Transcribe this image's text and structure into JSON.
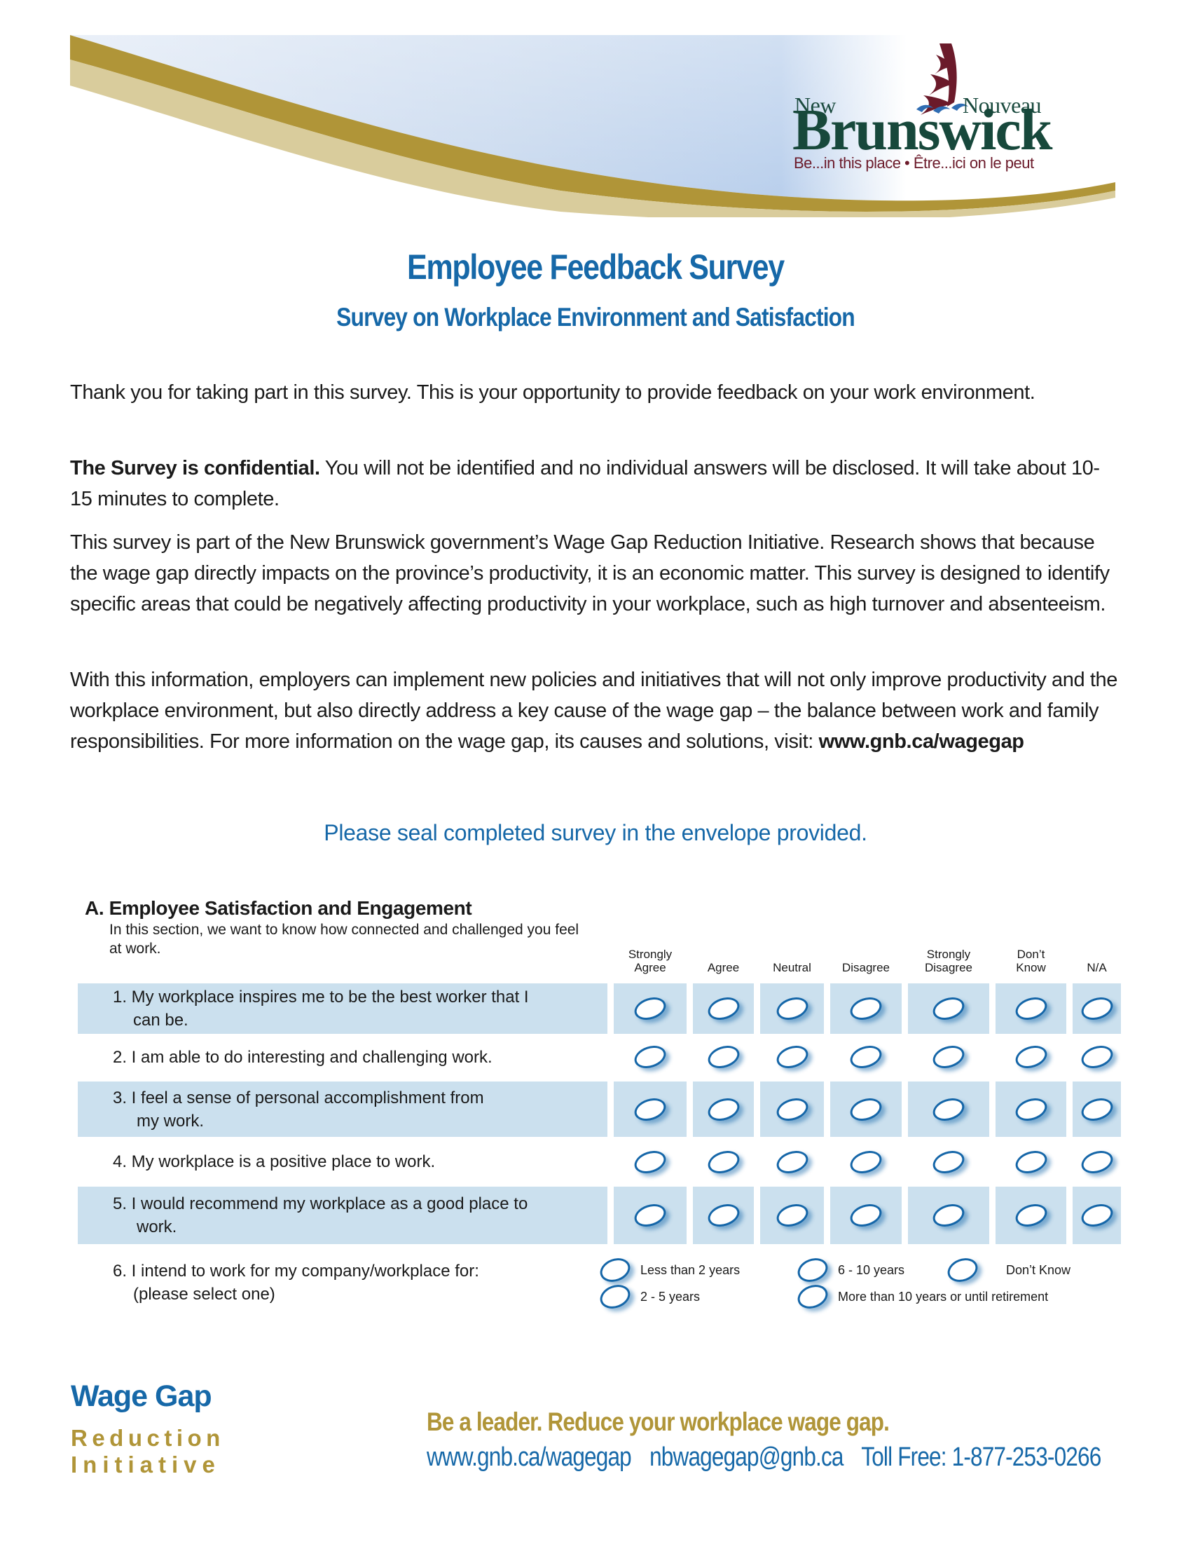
{
  "header": {
    "logo": {
      "word_left": "New",
      "word_right": "Nouveau",
      "name": "Brunswick",
      "tagline": "Be...in this place • Être...ici on le peut"
    },
    "colors": {
      "gold": "#b09538",
      "tan": "#d9cc9c",
      "sky": "#c9daef",
      "logo_green": "#17483b",
      "logo_maroon": "#6b1a2a"
    }
  },
  "title": "Employee Feedback Survey",
  "subtitle": "Survey on Workplace Environment and Satisfaction",
  "intro": {
    "p1": "Thank you for taking part in this survey. This is your opportunity to provide feedback on your work environment.",
    "p2_bold": "The Survey is confidential.",
    "p2_rest": " You will not be identified and no individual answers will be disclosed. It will take about 10-15 minutes to complete.",
    "p3": "This survey is part of the New Brunswick government’s Wage Gap Reduction Initiative. Research shows that because the wage gap directly impacts on the province’s productivity, it is an economic matter. This survey is designed to identify specific areas that could be negatively affecting productivity in your workplace, such as high turnover and absenteeism.",
    "p4": "With this information, employers can implement new policies and initiatives that will not only improve productivity and the workplace environment, but also directly address a key cause of the wage gap – the balance between work and family responsibilities. For more information on the wage gap, its causes and solutions, visit: ",
    "p4_link": "www.gnb.ca/wagegap"
  },
  "seal_notice": "Please seal completed survey in the envelope provided.",
  "section_a": {
    "title": "A. Employee Satisfaction and Engagement",
    "description": "In this section, we want to know how connected and challenged you feel at work.",
    "columns": [
      {
        "l1": "Strongly",
        "l2": "Agree"
      },
      {
        "l1": "",
        "l2": "Agree"
      },
      {
        "l1": "",
        "l2": "Neutral"
      },
      {
        "l1": "",
        "l2": "Disagree"
      },
      {
        "l1": "Strongly",
        "l2": "Disagree"
      },
      {
        "l1": "Don’t",
        "l2": "Know"
      },
      {
        "l1": "",
        "l2": "N/A"
      }
    ],
    "questions": [
      {
        "l1": "1. My workplace inspires me to be the best worker that I",
        "l2": "can be.",
        "selected": null
      },
      {
        "l1": "2. I am able to do interesting and challenging work.",
        "l2": "",
        "selected": null
      },
      {
        "l1": "3.  I feel a sense of personal accomplishment from",
        "l2": "my work.",
        "selected": null
      },
      {
        "l1": "4.  My workplace is a positive place to work.",
        "l2": "",
        "selected": null
      },
      {
        "l1": "5.  I would recommend my workplace as a good place to",
        "l2": "work.",
        "selected": null
      }
    ],
    "q6": {
      "l1": "6.  I intend to work for my company/workplace for:",
      "l2": "(please select one)",
      "options": [
        "Less than 2 years",
        "2 - 5 years",
        "6 - 10 years",
        "More than 10 years or until retirement",
        "Don’t Know"
      ],
      "selected": null
    }
  },
  "footer": {
    "brand_l1": "Wage Gap",
    "brand_l2": "Reduction",
    "brand_l3": "Initiative",
    "slogan": "Be a leader. Reduce your workplace wage gap.",
    "website": "www.gnb.ca/wagegap",
    "email": "nbwagegap@gnb.ca",
    "phone": "Toll Free: 1-877-253-0266"
  }
}
